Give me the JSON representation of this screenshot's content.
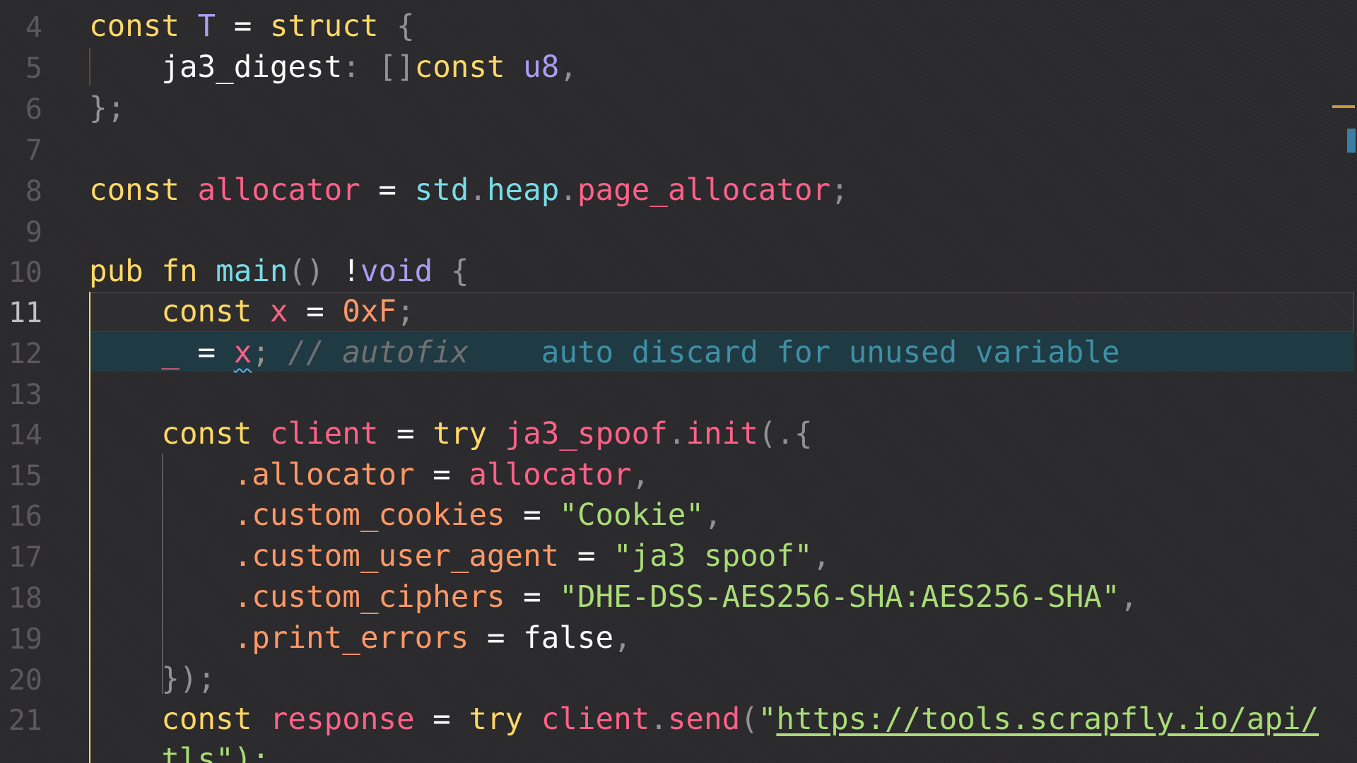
{
  "editor": {
    "line_numbers": [
      "4",
      "5",
      "6",
      "7",
      "8",
      "9",
      "10",
      "11",
      "12",
      "13",
      "14",
      "15",
      "16",
      "17",
      "18",
      "19",
      "20",
      "21"
    ],
    "active_line": "11",
    "colors": {
      "background": "#2b2a2c",
      "keyword": "#ffd866",
      "function": "#78dce8",
      "type": "#ab9df2",
      "variable": "#ff6188",
      "number": "#fc9867",
      "string": "#a9dc76",
      "comment": "#727072",
      "inlay_hint": "#3f8fa5",
      "autofix_background": "#1f3a42",
      "indent_guide_active": "#ffd866"
    },
    "tokens": {
      "const": "const",
      "struct": "struct",
      "pub": "pub",
      "fn": "fn",
      "try": "try",
      "void": "void",
      "u8": "u8",
      "false": "false",
      "l4_T": "T",
      "l5_field": "ja3_digest",
      "l5_slice": "[]",
      "l8_allocator": "allocator",
      "l8_std": "std",
      "l8_heap": "heap",
      "l8_page_allocator": "page_allocator",
      "l10_main": "main",
      "l11_x": "x",
      "l11_value": "0xF",
      "l12_underscore": "_",
      "l12_x": "x",
      "l12_comment": "// autofix",
      "l12_hint": "auto discard for unused variable",
      "l14_client": "client",
      "l14_ja3_spoof": "ja3_spoof",
      "l14_init": "init",
      "l15_field": ".allocator",
      "l15_value": "allocator",
      "l16_field": ".custom_cookies",
      "l16_value": "\"Cookie\"",
      "l17_field": ".custom_user_agent",
      "l17_value": "\"ja3 spoof\"",
      "l18_field": ".custom_ciphers",
      "l18_value": "\"DHE-DSS-AES256-SHA:AES256-SHA\"",
      "l19_field": ".print_errors",
      "l21_response": "response",
      "l21_client": "client",
      "l21_send": "send",
      "l21_quote_open": "\"",
      "l21_url": "https://tools.scrapfly.io/api/",
      "l22_url_cont": "tls",
      "l22_tail": "\");"
    }
  }
}
